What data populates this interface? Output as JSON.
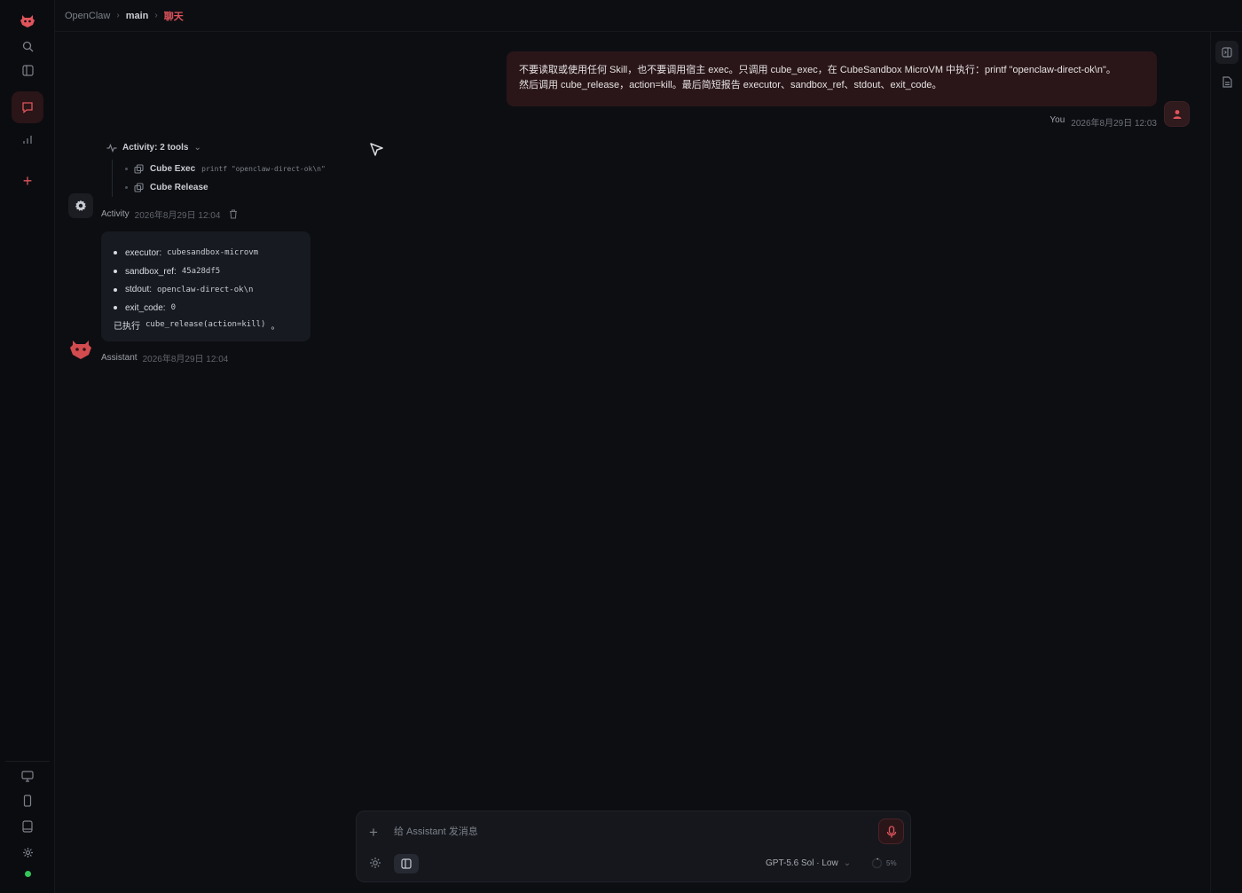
{
  "app": {
    "accent": "#e0545c",
    "background": "#0d0e12"
  },
  "breadcrumb": {
    "root": "OpenClaw",
    "session": "main",
    "page": "聊天"
  },
  "left_rail": {
    "items": [
      "robot-logo-icon",
      "search-icon",
      "sidebar-icon",
      "chat-icon",
      "chart-icon",
      "plus-icon"
    ],
    "bottom_items": [
      "monitor-icon",
      "phone-icon",
      "tablet-icon",
      "settings-icon"
    ],
    "status_color": "#34c759"
  },
  "user_message": {
    "line1": "不要读取或使用任何 Skill，也不要调用宿主 exec。只调用 cube_exec，在 CubeSandbox MicroVM 中执行：printf \"openclaw-direct-ok\\n\"。",
    "line2": "然后调用 cube_release，action=kill。最后简短报告 executor、sandbox_ref、stdout、exit_code。",
    "author": "You",
    "timestamp": "2026年8月29日 12:03"
  },
  "activity": {
    "header": "Activity: 2 tools",
    "tools": [
      {
        "name": "Cube Exec",
        "args": "printf \"openclaw-direct-ok\\n\""
      },
      {
        "name": "Cube Release",
        "args": ""
      }
    ],
    "author": "Activity",
    "timestamp": "2026年8月29日 12:04"
  },
  "assistant_message": {
    "items": [
      {
        "key": "executor:",
        "value": "cubesandbox-microvm"
      },
      {
        "key": "sandbox_ref:",
        "value": "45a28df5"
      },
      {
        "key": "stdout:",
        "value": "openclaw-direct-ok\\n"
      },
      {
        "key": "exit_code:",
        "value": "0"
      }
    ],
    "final_prefix": "已执行",
    "final_code": "cube_release(action=kill)",
    "final_suffix": "。",
    "author": "Assistant",
    "timestamp": "2026年8月29日 12:04"
  },
  "composer": {
    "placeholder": "给 Assistant 发消息",
    "model": "GPT-5.6 Sol · Low",
    "context": "5%"
  }
}
